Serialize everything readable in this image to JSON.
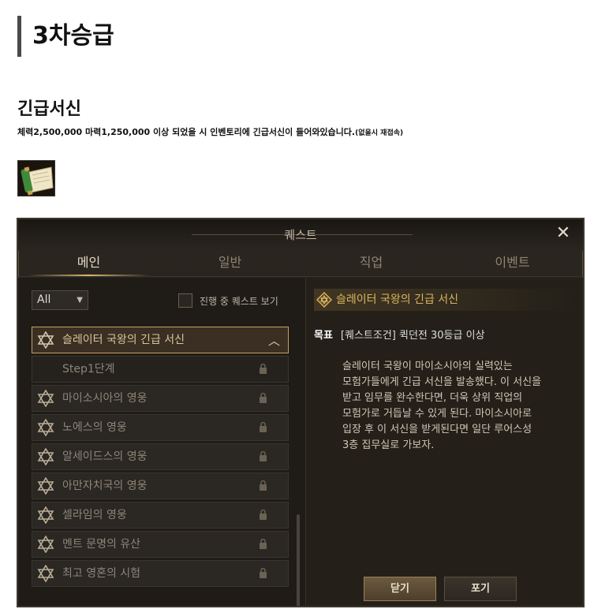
{
  "page": {
    "title": "3차승급",
    "section_title": "긴급서신",
    "description": "체력2,500,000 마력1,250,000 이상 되었을 시 인벤토리에 긴급서신이 들어와있습니다.",
    "description_note": "(없을시 재접속)"
  },
  "window": {
    "title": "퀘스트",
    "close_icon": "close-icon",
    "tabs": [
      {
        "label": "메인",
        "active": true
      },
      {
        "label": "일반",
        "active": false
      },
      {
        "label": "직업",
        "active": false
      },
      {
        "label": "이벤트",
        "active": false
      }
    ],
    "filter": {
      "selected": "All"
    },
    "checkbox_label": "진행 중 퀘스트 보기",
    "quests": [
      {
        "label": "슬레이터 국왕의 긴급 서신",
        "selected": true
      },
      {
        "label": "Step1단계",
        "step": true
      },
      {
        "label": "마이소시아의 영웅"
      },
      {
        "label": "노에스의 영웅"
      },
      {
        "label": "알세이드스의 영웅"
      },
      {
        "label": "아만자치국의 영웅"
      },
      {
        "label": "셀라임의 영웅"
      },
      {
        "label": "멘트 문명의 유산"
      },
      {
        "label": "최고 영혼의 시험"
      }
    ],
    "detail": {
      "title": "슬레이터 국왕의 긴급 서신",
      "goal_label": "목표",
      "goal_text": "[퀘스트조건] 퀵던전 30등급 이상",
      "body": "슬레이터 국왕이 마이소시아의 실력있는\n모험가들에게 긴급 서신을 발송했다. 이 서신을\n받고 임무를 완수한다면, 더욱 상위 직업의\n모험가로 거듭날 수 있게 된다. 마이소시아로\n입장 후 이 서신을 받게된다면 일단 루어스성\n3층 집무실로 가보자."
    },
    "buttons": {
      "close": "닫기",
      "abandon": "포기"
    }
  },
  "colors": {
    "accent": "#d9b45e",
    "window_bg": "#23201b"
  }
}
